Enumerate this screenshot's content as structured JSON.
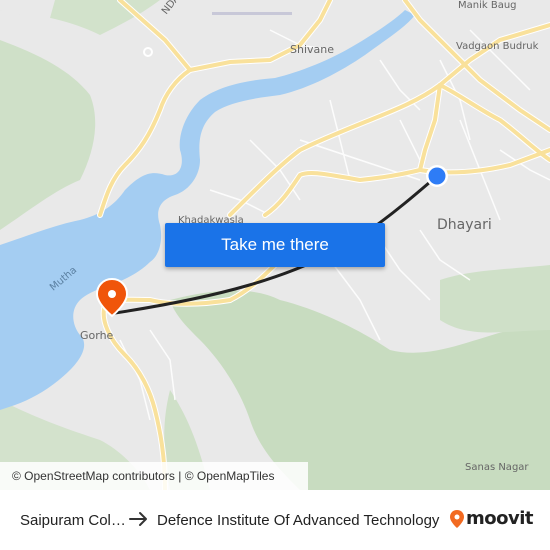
{
  "map": {
    "labels": {
      "nda_road": "NDA Road",
      "shivane": "Shivane",
      "manik_baug": "Manik Baug",
      "vadgaon_budruk": "Vadgaon Budruk",
      "dhayari": "Dhayari",
      "khadakwasla": "Khadakwasla",
      "mutha": "Mutha",
      "gorhe": "Gorhe",
      "sanas_nagar": "Sanas Nagar"
    },
    "cta_label": "Take me there",
    "attribution": "© OpenStreetMap contributors | © OpenMapTiles",
    "colors": {
      "water": "#a4cdf2",
      "green": "#c7dcc0",
      "road_major": "#f9e19b",
      "origin_dot": "#2e7cf6",
      "destination_pin": "#f0550a",
      "route": "#222222"
    }
  },
  "footer": {
    "from": "Saipuram Colony",
    "to": "Defence Institute Of Advanced Technology",
    "brand": "moovit"
  }
}
